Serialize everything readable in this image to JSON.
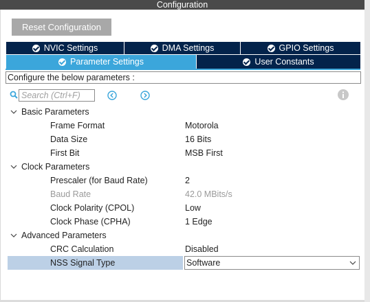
{
  "window": {
    "title": "Configuration"
  },
  "toolbar": {
    "reset_label": "Reset Configuration"
  },
  "tabs": [
    {
      "label": "NVIC Settings",
      "active": false
    },
    {
      "label": "DMA Settings",
      "active": false
    },
    {
      "label": "GPIO Settings",
      "active": false
    },
    {
      "label": "Parameter Settings",
      "active": true
    },
    {
      "label": "User Constants",
      "active": false
    }
  ],
  "configure_text": "Configure the below parameters :",
  "search": {
    "placeholder": "Search (Ctrl+F)"
  },
  "groups": [
    {
      "label": "Basic Parameters",
      "params": [
        {
          "name": "Frame Format",
          "value": "Motorola"
        },
        {
          "name": "Data Size",
          "value": "16 Bits"
        },
        {
          "name": "First Bit",
          "value": "MSB First"
        }
      ]
    },
    {
      "label": "Clock Parameters",
      "params": [
        {
          "name": "Prescaler (for Baud Rate)",
          "value": "2"
        },
        {
          "name": "Baud Rate",
          "value": "42.0 MBits/s",
          "disabled": true
        },
        {
          "name": "Clock Polarity (CPOL)",
          "value": "Low"
        },
        {
          "name": "Clock Phase (CPHA)",
          "value": "1 Edge"
        }
      ]
    },
    {
      "label": "Advanced Parameters",
      "params": [
        {
          "name": "CRC Calculation",
          "value": "Disabled"
        },
        {
          "name": "NSS Signal Type",
          "value": "Software",
          "selected": true
        }
      ]
    }
  ],
  "colors": {
    "tab_bg": "#03234b",
    "tab_active": "#3ba6db",
    "selected_row": "#bcd0e6"
  }
}
